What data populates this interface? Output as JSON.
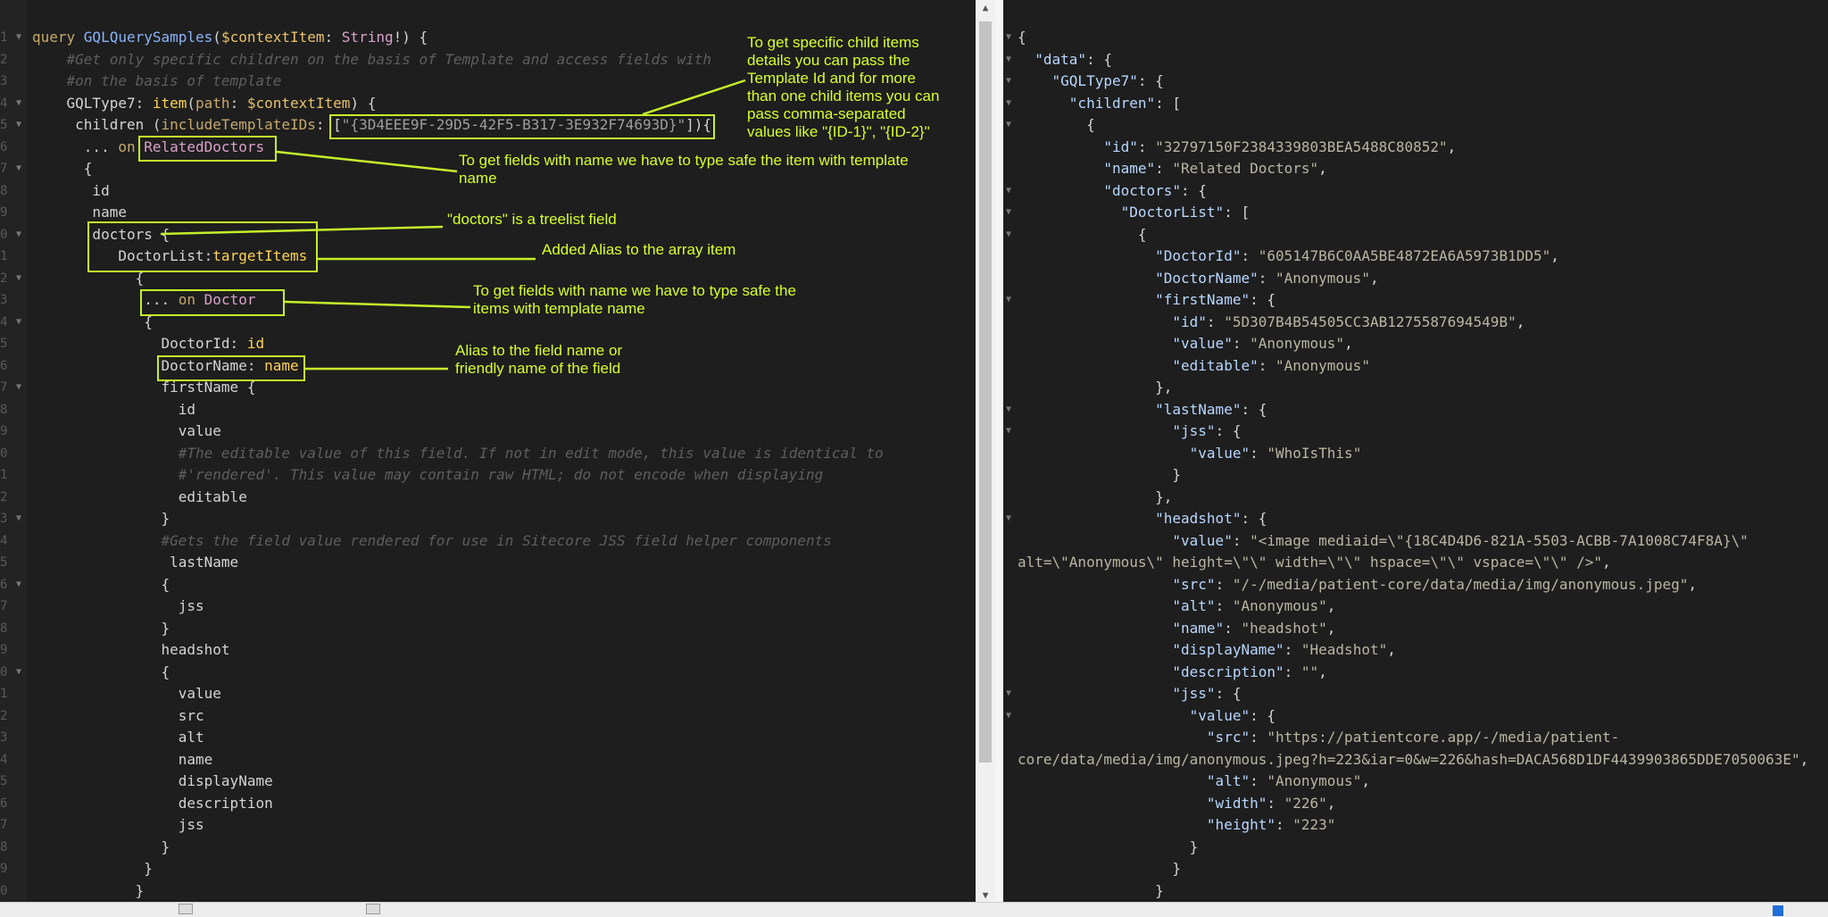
{
  "query_editor": {
    "line_numbers": [
      "1",
      "2",
      "3",
      "4",
      "5",
      "6",
      "7",
      "8",
      "9",
      "0",
      "1",
      "2",
      "3",
      "4",
      "5",
      "6",
      "7",
      "8",
      "9",
      "0",
      "1",
      "2",
      "3",
      "4",
      "5",
      "6",
      "7",
      "8",
      "9",
      "0",
      "1",
      "2",
      "3",
      "4",
      "5",
      "6",
      "7",
      "8",
      "9",
      "0"
    ],
    "lines": [
      [
        [
          "kw",
          "query "
        ],
        [
          "fn",
          "GQLQuerySamples"
        ],
        [
          "pun",
          "("
        ],
        [
          "var",
          "$contextItem"
        ],
        [
          "pun",
          ": "
        ],
        [
          "type",
          "String"
        ],
        [
          "pun",
          "!) {"
        ]
      ],
      [
        [
          "cm",
          "    #Get only specific children on the basis of Template and access fields with"
        ]
      ],
      [
        [
          "cm",
          "    #on the basis of template"
        ]
      ],
      [
        [
          "pun",
          "    GQLType7: "
        ],
        [
          "fld",
          "item"
        ],
        [
          "pun",
          "("
        ],
        [
          "kw",
          "path"
        ],
        [
          "pun",
          ": "
        ],
        [
          "var",
          "$contextItem"
        ],
        [
          "pun",
          ") {"
        ]
      ],
      [
        [
          "pun",
          "     children ("
        ],
        [
          "kw",
          "includeTemplateIDs"
        ],
        [
          "pun",
          ": ["
        ],
        [
          "str",
          "\"{3D4EEE9F-29D5-42F5-B317-3E932F74693D}\""
        ],
        [
          "pun",
          "]){"
        ]
      ],
      [
        [
          "pun",
          "      ... "
        ],
        [
          "kw",
          "on "
        ],
        [
          "type",
          "RelatedDoctors"
        ]
      ],
      [
        [
          "pun",
          "      {"
        ]
      ],
      [
        [
          "pun",
          "       id"
        ]
      ],
      [
        [
          "pun",
          "       name"
        ]
      ],
      [
        [
          "pun",
          "       doctors {"
        ]
      ],
      [
        [
          "pun",
          "          DoctorList:"
        ],
        [
          "fld",
          "targetItems"
        ]
      ],
      [
        [
          "pun",
          "            {"
        ]
      ],
      [
        [
          "pun",
          "             ... "
        ],
        [
          "kw",
          "on "
        ],
        [
          "type",
          "Doctor"
        ]
      ],
      [
        [
          "pun",
          "             {"
        ]
      ],
      [
        [
          "pun",
          "               DoctorId: "
        ],
        [
          "fld",
          "id"
        ]
      ],
      [
        [
          "pun",
          "               DoctorName: "
        ],
        [
          "fld",
          "name"
        ]
      ],
      [
        [
          "pun",
          "               firstName {"
        ]
      ],
      [
        [
          "pun",
          "                 id"
        ]
      ],
      [
        [
          "pun",
          "                 value"
        ]
      ],
      [
        [
          "cm",
          "                 #The editable value of this field. If not in edit mode, this value is identical to"
        ]
      ],
      [
        [
          "cm",
          "                 #'rendered'. This value may contain raw HTML; do not encode when displaying"
        ]
      ],
      [
        [
          "pun",
          "                 editable"
        ]
      ],
      [
        [
          "pun",
          "               }"
        ]
      ],
      [
        [
          "cm",
          "               #Gets the field value rendered for use in Sitecore JSS field helper components"
        ]
      ],
      [
        [
          "pun",
          "                lastName"
        ]
      ],
      [
        [
          "pun",
          "               {"
        ]
      ],
      [
        [
          "pun",
          "                 jss"
        ]
      ],
      [
        [
          "pun",
          "               }"
        ]
      ],
      [
        [
          "pun",
          "               headshot"
        ]
      ],
      [
        [
          "pun",
          "               {"
        ]
      ],
      [
        [
          "pun",
          "                 value"
        ]
      ],
      [
        [
          "pun",
          "                 src"
        ]
      ],
      [
        [
          "pun",
          "                 alt"
        ]
      ],
      [
        [
          "pun",
          "                 name"
        ]
      ],
      [
        [
          "pun",
          "                 displayName"
        ]
      ],
      [
        [
          "pun",
          "                 description"
        ]
      ],
      [
        [
          "pun",
          "                 jss"
        ]
      ],
      [
        [
          "pun",
          "               }"
        ]
      ],
      [
        [
          "pun",
          "             }"
        ]
      ],
      [
        [
          "pun",
          "            }"
        ]
      ]
    ]
  },
  "result_viewer": {
    "lines": [
      [
        [
          "pun",
          "{"
        ]
      ],
      [
        [
          "pun",
          "  "
        ],
        [
          "jkey",
          "\"data\""
        ],
        [
          "pun",
          ": {"
        ]
      ],
      [
        [
          "pun",
          "    "
        ],
        [
          "jkey",
          "\"GQLType7\""
        ],
        [
          "pun",
          ": {"
        ]
      ],
      [
        [
          "pun",
          "      "
        ],
        [
          "jkey",
          "\"children\""
        ],
        [
          "pun",
          ": ["
        ]
      ],
      [
        [
          "pun",
          "        {"
        ]
      ],
      [
        [
          "pun",
          "          "
        ],
        [
          "jkey",
          "\"id\""
        ],
        [
          "pun",
          ": "
        ],
        [
          "jstr",
          "\"32797150F2384339803BEA5488C80852\""
        ],
        [
          "pun",
          ","
        ]
      ],
      [
        [
          "pun",
          "          "
        ],
        [
          "jkey",
          "\"name\""
        ],
        [
          "pun",
          ": "
        ],
        [
          "jstr",
          "\"Related Doctors\""
        ],
        [
          "pun",
          ","
        ]
      ],
      [
        [
          "pun",
          "          "
        ],
        [
          "jkey",
          "\"doctors\""
        ],
        [
          "pun",
          ": {"
        ]
      ],
      [
        [
          "pun",
          "            "
        ],
        [
          "jkey",
          "\"DoctorList\""
        ],
        [
          "pun",
          ": ["
        ]
      ],
      [
        [
          "pun",
          "              {"
        ]
      ],
      [
        [
          "pun",
          "                "
        ],
        [
          "jkey",
          "\"DoctorId\""
        ],
        [
          "pun",
          ": "
        ],
        [
          "jstr",
          "\"605147B6C0AA5BE4872EA6A5973B1DD5\""
        ],
        [
          "pun",
          ","
        ]
      ],
      [
        [
          "pun",
          "                "
        ],
        [
          "jkey",
          "\"DoctorName\""
        ],
        [
          "pun",
          ": "
        ],
        [
          "jstr",
          "\"Anonymous\""
        ],
        [
          "pun",
          ","
        ]
      ],
      [
        [
          "pun",
          "                "
        ],
        [
          "jkey",
          "\"firstName\""
        ],
        [
          "pun",
          ": {"
        ]
      ],
      [
        [
          "pun",
          "                  "
        ],
        [
          "jkey",
          "\"id\""
        ],
        [
          "pun",
          ": "
        ],
        [
          "jstr",
          "\"5D307B4B54505CC3AB1275587694549B\""
        ],
        [
          "pun",
          ","
        ]
      ],
      [
        [
          "pun",
          "                  "
        ],
        [
          "jkey",
          "\"value\""
        ],
        [
          "pun",
          ": "
        ],
        [
          "jstr",
          "\"Anonymous\""
        ],
        [
          "pun",
          ","
        ]
      ],
      [
        [
          "pun",
          "                  "
        ],
        [
          "jkey",
          "\"editable\""
        ],
        [
          "pun",
          ": "
        ],
        [
          "jstr",
          "\"Anonymous\""
        ]
      ],
      [
        [
          "pun",
          "                },"
        ]
      ],
      [
        [
          "pun",
          "                "
        ],
        [
          "jkey",
          "\"lastName\""
        ],
        [
          "pun",
          ": {"
        ]
      ],
      [
        [
          "pun",
          "                  "
        ],
        [
          "jkey",
          "\"jss\""
        ],
        [
          "pun",
          ": {"
        ]
      ],
      [
        [
          "pun",
          "                    "
        ],
        [
          "jkey",
          "\"value\""
        ],
        [
          "pun",
          ": "
        ],
        [
          "jstr",
          "\"WhoIsThis\""
        ]
      ],
      [
        [
          "pun",
          "                  }"
        ]
      ],
      [
        [
          "pun",
          "                },"
        ]
      ],
      [
        [
          "pun",
          "                "
        ],
        [
          "jkey",
          "\"headshot\""
        ],
        [
          "pun",
          ": {"
        ]
      ],
      [
        [
          "pun",
          "                  "
        ],
        [
          "jkey",
          "\"value\""
        ],
        [
          "pun",
          ": "
        ],
        [
          "jstr",
          "\"<image mediaid=\\\"{18C4D4D6-821A-5503-ACBB-7A1008C74F8A}\\\""
        ]
      ],
      [
        [
          "jstr",
          "alt=\\\"Anonymous\\\" height=\\\"\\\" width=\\\"\\\" hspace=\\\"\\\" vspace=\\\"\\\" />\""
        ],
        [
          "pun",
          ","
        ]
      ],
      [
        [
          "pun",
          "                  "
        ],
        [
          "jkey",
          "\"src\""
        ],
        [
          "pun",
          ": "
        ],
        [
          "jstr",
          "\"/-/media/patient-core/data/media/img/anonymous.jpeg\""
        ],
        [
          "pun",
          ","
        ]
      ],
      [
        [
          "pun",
          "                  "
        ],
        [
          "jkey",
          "\"alt\""
        ],
        [
          "pun",
          ": "
        ],
        [
          "jstr",
          "\"Anonymous\""
        ],
        [
          "pun",
          ","
        ]
      ],
      [
        [
          "pun",
          "                  "
        ],
        [
          "jkey",
          "\"name\""
        ],
        [
          "pun",
          ": "
        ],
        [
          "jstr",
          "\"headshot\""
        ],
        [
          "pun",
          ","
        ]
      ],
      [
        [
          "pun",
          "                  "
        ],
        [
          "jkey",
          "\"displayName\""
        ],
        [
          "pun",
          ": "
        ],
        [
          "jstr",
          "\"Headshot\""
        ],
        [
          "pun",
          ","
        ]
      ],
      [
        [
          "pun",
          "                  "
        ],
        [
          "jkey",
          "\"description\""
        ],
        [
          "pun",
          ": "
        ],
        [
          "jstr",
          "\"\""
        ],
        [
          "pun",
          ","
        ]
      ],
      [
        [
          "pun",
          "                  "
        ],
        [
          "jkey",
          "\"jss\""
        ],
        [
          "pun",
          ": {"
        ]
      ],
      [
        [
          "pun",
          "                    "
        ],
        [
          "jkey",
          "\"value\""
        ],
        [
          "pun",
          ": {"
        ]
      ],
      [
        [
          "pun",
          "                      "
        ],
        [
          "jkey",
          "\"src\""
        ],
        [
          "pun",
          ": "
        ],
        [
          "jstr",
          "\"https://patientcore.app/-/media/patient-"
        ]
      ],
      [
        [
          "jstr",
          "core/data/media/img/anonymous.jpeg?h=223&iar=0&w=226&hash=DACA568D1DF4439903865DDE7050063E\""
        ],
        [
          "pun",
          ","
        ]
      ],
      [
        [
          "pun",
          "                      "
        ],
        [
          "jkey",
          "\"alt\""
        ],
        [
          "pun",
          ": "
        ],
        [
          "jstr",
          "\"Anonymous\""
        ],
        [
          "pun",
          ","
        ]
      ],
      [
        [
          "pun",
          "                      "
        ],
        [
          "jkey",
          "\"width\""
        ],
        [
          "pun",
          ": "
        ],
        [
          "jstr",
          "\"226\""
        ],
        [
          "pun",
          ","
        ]
      ],
      [
        [
          "pun",
          "                      "
        ],
        [
          "jkey",
          "\"height\""
        ],
        [
          "pun",
          ": "
        ],
        [
          "jstr",
          "\"223\""
        ]
      ],
      [
        [
          "pun",
          "                    }"
        ]
      ],
      [
        [
          "pun",
          "                  }"
        ]
      ],
      [
        [
          "pun",
          "                }"
        ]
      ]
    ]
  },
  "annotations": {
    "template_id": "To get specific child items\ndetails you can pass the\nTemplate Id and for more\nthan one child items you can\npass comma-separated\nvalues like \"{ID-1}\", \"{ID-2}\"",
    "type_safe_item": "To get fields with name we have to type safe the item with template\nname",
    "treelist": "\"doctors\" is a treelist field",
    "alias_array": "Added Alias to the array item",
    "type_safe_items": "To get fields with name we have to type safe the\nitems with template name",
    "alias_field": "Alias to the field name or\nfriendly name of the field"
  },
  "colors": {
    "background": "#1e1e1e",
    "annotation": "#d7ff2a"
  }
}
